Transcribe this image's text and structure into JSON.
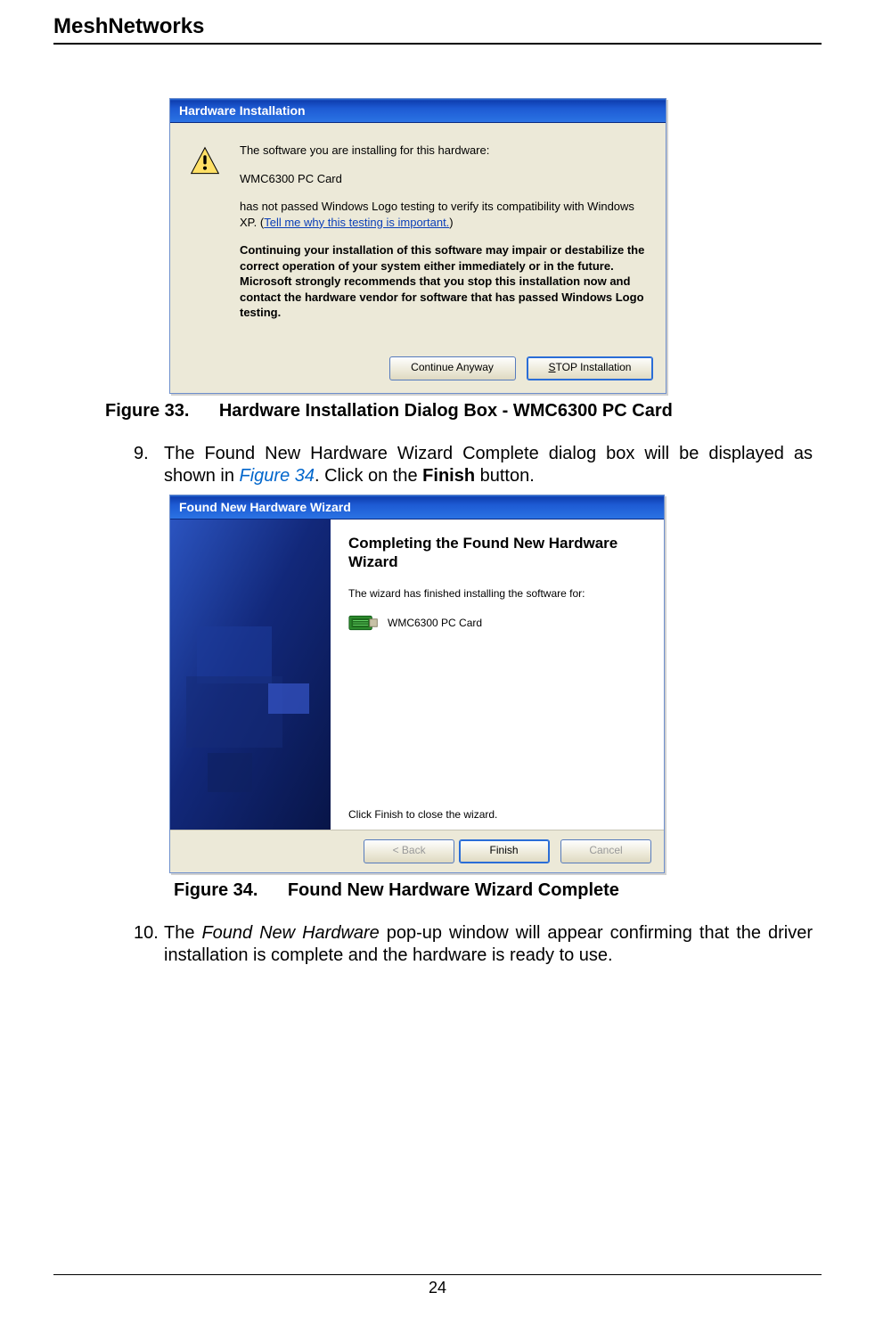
{
  "header": "MeshNetworks",
  "dialog1": {
    "title": "Hardware Installation",
    "line1": "The software you are installing for this hardware:",
    "hwname": "WMC6300 PC Card",
    "line2a": "has not passed Windows Logo testing to verify its compatibility with Windows XP. (",
    "link": "Tell me why this testing is important.",
    "line2b": ")",
    "warning": "Continuing your installation of this software may impair or destabilize the correct operation of your system either immediately or in the future. Microsoft strongly recommends that you stop this installation now and contact the hardware vendor for software that has passed Windows Logo testing.",
    "btn_continue": "Continue Anyway",
    "btn_stop": "STOP Installation"
  },
  "fig33_caption_label": "Figure 33.",
  "fig33_caption_text": "Hardware Installation Dialog Box - WMC6300 PC Card",
  "step9_num": "9.",
  "step9_a": "The Found New Hardware Wizard Complete dialog box will be displayed as shown in ",
  "step9_ref": "Figure 34",
  "step9_b": ".  Click on the ",
  "step9_bold": "Finish",
  "step9_c": " button.",
  "dialog2": {
    "title": "Found New Hardware Wizard",
    "heading": "Completing the Found New Hardware Wizard",
    "line1": "The wizard has finished installing the software for:",
    "hwname": "WMC6300 PC Card",
    "line2": "Click Finish to close the wizard.",
    "btn_back": "< Back",
    "btn_finish": "Finish",
    "btn_cancel": "Cancel"
  },
  "fig34_caption_label": "Figure 34.",
  "fig34_caption_text": "Found New Hardware Wizard Complete",
  "step10_num": "10.",
  "step10_a": "The ",
  "step10_italic": "Found New Hardware",
  "step10_b": " pop-up window will appear confirming that the driver installation is complete and the hardware is ready to use.",
  "page_number": "24"
}
